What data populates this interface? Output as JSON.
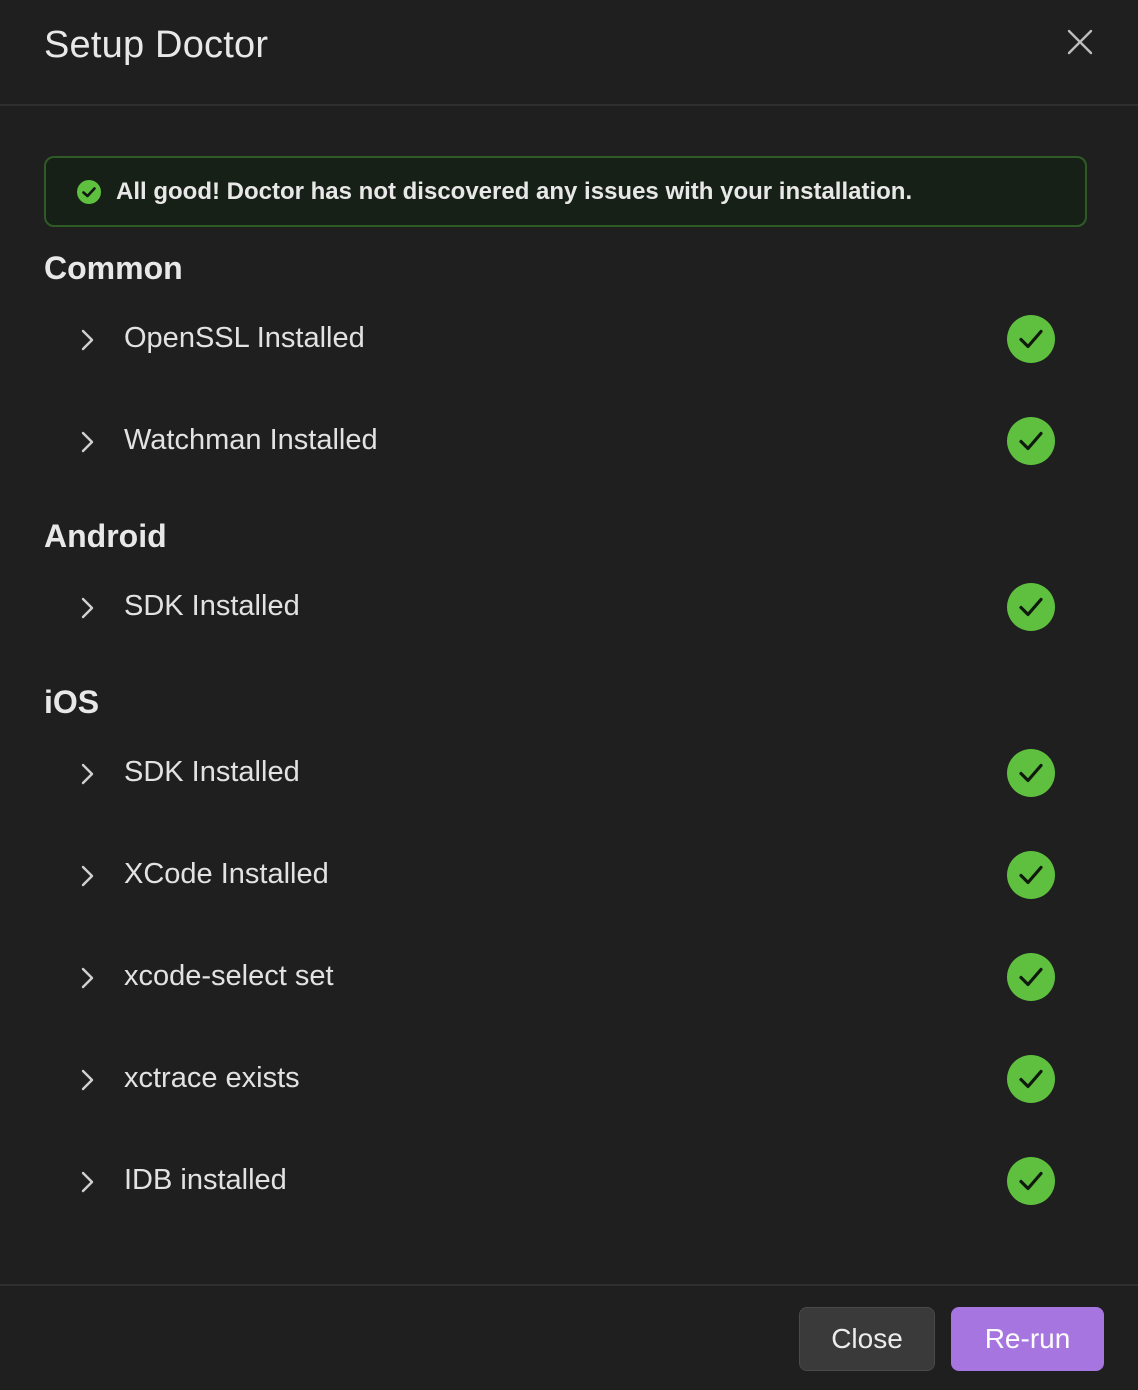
{
  "modal": {
    "title": "Setup Doctor"
  },
  "banner": {
    "message": "All good! Doctor has not discovered any issues with your installation."
  },
  "sections": {
    "common": {
      "title": "Common",
      "checks": [
        {
          "label": "OpenSSL Installed",
          "status": "ok"
        },
        {
          "label": "Watchman Installed",
          "status": "ok"
        }
      ]
    },
    "android": {
      "title": "Android",
      "checks": [
        {
          "label": "SDK Installed",
          "status": "ok"
        }
      ]
    },
    "ios": {
      "title": "iOS",
      "checks": [
        {
          "label": "SDK Installed",
          "status": "ok"
        },
        {
          "label": "XCode Installed",
          "status": "ok"
        },
        {
          "label": "xcode-select set",
          "status": "ok"
        },
        {
          "label": "xctrace exists",
          "status": "ok"
        },
        {
          "label": "IDB installed",
          "status": "ok"
        }
      ]
    }
  },
  "footer": {
    "close_label": "Close",
    "rerun_label": "Re-run"
  },
  "colors": {
    "background": "#1f1f1f",
    "success": "#5fbf3f",
    "banner_border": "#2e5b25",
    "accent": "#a675e0"
  },
  "icons": {
    "dialog_close": "close-icon",
    "expand": "chevron-right-icon",
    "status_ok": "check-circle-icon"
  }
}
